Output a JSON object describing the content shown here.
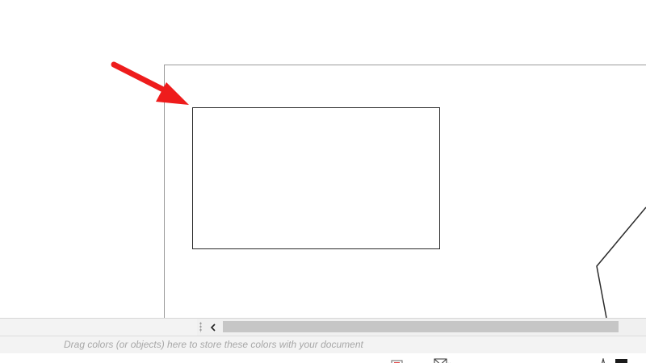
{
  "canvas": {
    "page_border_color": "#9a9a9a",
    "rectangle_stroke_color": "#2a2a2a",
    "annotation_arrow_color": "#ee1c1c",
    "polygon_stroke_color": "#2a2a2a"
  },
  "scrollbar": {
    "scroll_left_icon": "chevron-left-icon",
    "thumb_color": "#c6c6c6"
  },
  "palette": {
    "hint_text": "Drag colors (or objects) here to store these colors with your document"
  },
  "status_bar": {
    "fill_icon": "fill-icon",
    "outline_icon": "outline-envelope-icon",
    "pen_icon": "pen-icon",
    "outline_color": "#1a1a1a"
  }
}
